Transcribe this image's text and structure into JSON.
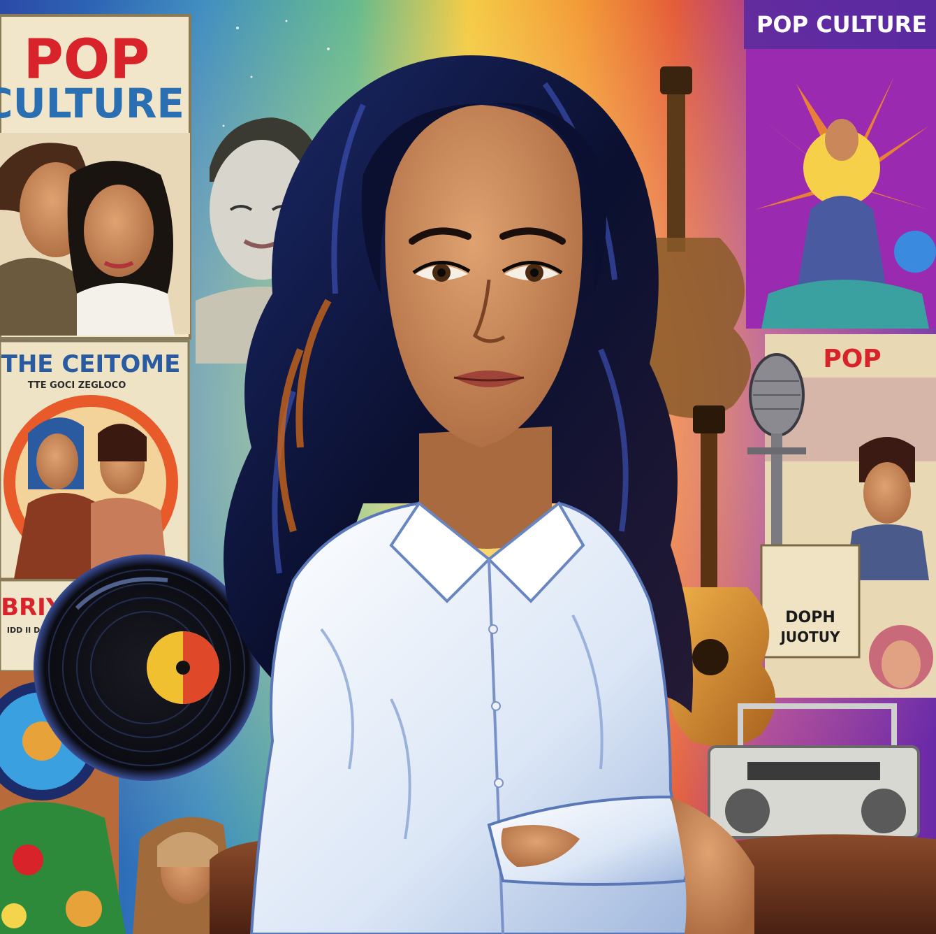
{
  "texts": {
    "left_poster_line1": "POP",
    "left_poster_line2": "CULTURE",
    "banner": "POP CULTURE",
    "mid_poster_title": "THE CEITOME",
    "mid_poster_sub": "TTE GOCI ZEGLOCO",
    "bottom_left_title": "BRIYH",
    "bottom_left_sub": "IDD II DOUIR II",
    "right_poster_title": "POP",
    "right_small_line1": "DOPH",
    "right_small_line2": "JUOTUY"
  },
  "colors": {
    "hair": "#0d1230",
    "hair_highlight": "#3a4fb0",
    "skin": "#c98a5c",
    "shirt": "#e8eef8",
    "poster_red": "#d9232a",
    "poster_blue": "#2a6fb2",
    "banner_text": "#ffffff"
  }
}
